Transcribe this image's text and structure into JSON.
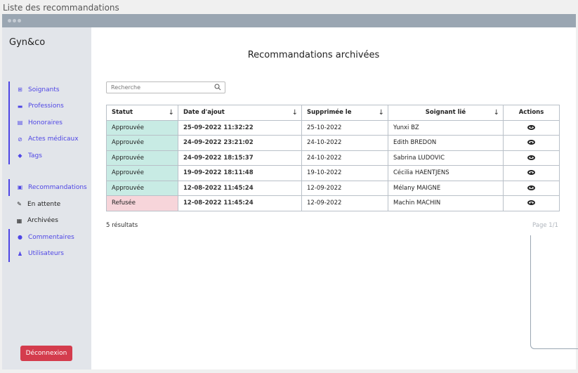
{
  "window": {
    "title": "Liste des recommandations"
  },
  "sidebar": {
    "brand": "Gyn&co",
    "group1": [
      {
        "label": "Soignants",
        "icon": "plus-square-icon"
      },
      {
        "label": "Professions",
        "icon": "briefcase-icon"
      },
      {
        "label": "Honoraires",
        "icon": "receipt-icon"
      },
      {
        "label": "Actes médicaux",
        "icon": "link-icon"
      },
      {
        "label": "Tags",
        "icon": "tag-icon"
      }
    ],
    "recommendations": {
      "label": "Recommandations",
      "icon": "clipboard-icon"
    },
    "sub": [
      {
        "label": "En attente",
        "icon": "pencil-icon"
      },
      {
        "label": "Archivées",
        "icon": "archive-icon"
      }
    ],
    "group3": [
      {
        "label": "Commentaires",
        "icon": "chat-icon"
      },
      {
        "label": "Utilisateurs",
        "icon": "users-icon"
      }
    ],
    "logout_label": "Déconnexion"
  },
  "main": {
    "title": "Recommandations archivées",
    "search_placeholder": "Recherche",
    "columns": [
      "Statut",
      "Date d'ajout",
      "Supprimée le",
      "Soignant lié",
      "Actions"
    ],
    "rows": [
      {
        "status": "Approuvée",
        "added": "25-09-2022 11:32:22",
        "deleted": "25-10-2022",
        "caregiver": "Yunxi BZ"
      },
      {
        "status": "Approuvée",
        "added": "24-09-2022 23:21:02",
        "deleted": "24-10-2022",
        "caregiver": "Edith BREDON"
      },
      {
        "status": "Approuvée",
        "added": "24-09-2022 18:15:37",
        "deleted": "24-10-2022",
        "caregiver": "Sabrina LUDOVIC"
      },
      {
        "status": "Approuvée",
        "added": "19-09-2022 18:11:48",
        "deleted": "19-10-2022",
        "caregiver": "Cécilia HAENTJENS"
      },
      {
        "status": "Approuvée",
        "added": "12-08-2022 11:45:24",
        "deleted": "12-09-2022",
        "caregiver": "Mélany MAIGNE"
      },
      {
        "status": "Refusée",
        "added": "12-08-2022 11:45:24",
        "deleted": "12-09-2022",
        "caregiver": "Machin MACHIN"
      }
    ],
    "results": "5 résultats",
    "pager": "Page 1/1"
  },
  "colors": {
    "accent": "#4f46e5",
    "approved": "#c8ebe4",
    "refused": "#f7d5da",
    "logout": "#d43c4d"
  }
}
